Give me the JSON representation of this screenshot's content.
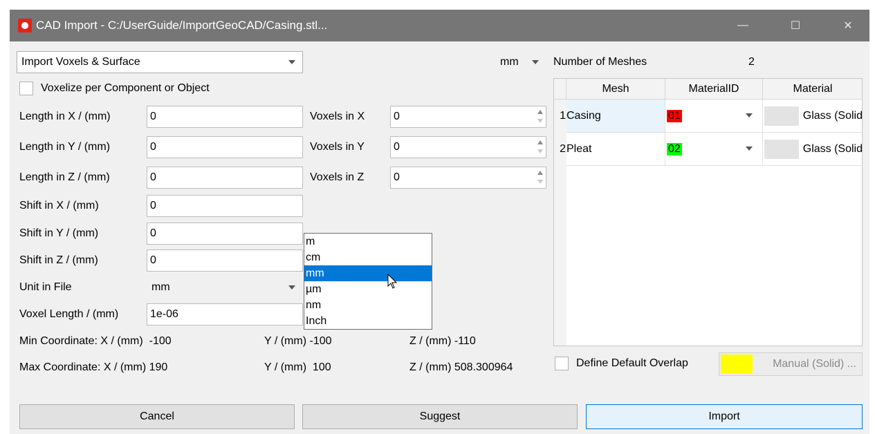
{
  "window": {
    "title": "CAD Import - C:/UserGuide/ImportGeoCAD/Casing.stl...",
    "minimize": "—",
    "maximize": "☐",
    "close": "✕"
  },
  "import_mode": {
    "value": "Import Voxels & Surface"
  },
  "unit_combo": {
    "value": "mm"
  },
  "voxelize_checkbox": {
    "label": "Voxelize per Component or Object",
    "checked": false
  },
  "fields": {
    "length_x": {
      "label": "Length in X / (mm)",
      "value": "0"
    },
    "length_y": {
      "label": "Length in Y / (mm)",
      "value": "0"
    },
    "length_z": {
      "label": "Length in Z / (mm)",
      "value": "0"
    },
    "shift_x": {
      "label": "Shift  in X / (mm)",
      "value": "0"
    },
    "shift_y": {
      "label": "Shift  in Y / (mm)",
      "value": "0"
    },
    "shift_z": {
      "label": "Shift  in Z / (mm)",
      "value": "0"
    },
    "voxels_x": {
      "label": "Voxels in X",
      "value": "0"
    },
    "voxels_y": {
      "label": "Voxels in Y",
      "value": "0"
    },
    "voxels_z": {
      "label": "Voxels in Z",
      "value": "0"
    },
    "unit_in_file": {
      "label": "Unit in File",
      "value": "mm"
    },
    "voxel_length": {
      "label": "Voxel Length / (mm)",
      "value": "1e-06"
    }
  },
  "unit_dropdown": {
    "options": [
      "m",
      "cm",
      "mm",
      "µm",
      "nm",
      "Inch"
    ],
    "selected": "mm"
  },
  "coords": {
    "min_label": "Min Coordinate: X / (mm)",
    "min_x": "-100",
    "min_y_label": "Y / (mm)",
    "min_y": "-100",
    "min_z_label": "Z / (mm)",
    "min_z": "-110",
    "max_label": "Max Coordinate: X / (mm)",
    "max_x": "190",
    "max_y_label": "Y / (mm)",
    "max_y": "100",
    "max_z_label": "Z / (mm)",
    "max_z": "508.300964"
  },
  "meshes": {
    "count_label": "Number of Meshes",
    "count": "2",
    "headers": [
      "Mesh",
      "MaterialID",
      "Material"
    ],
    "rows": [
      {
        "index": "1",
        "mesh": "Casing",
        "material_id": "01",
        "id_color": "#ff0000",
        "material": "Glass (Solid"
      },
      {
        "index": "2",
        "mesh": "Pleat",
        "material_id": "02",
        "id_color": "#00ff00",
        "material": "Glass (Solid"
      }
    ]
  },
  "overlap": {
    "label": "Define Default Overlap",
    "checked": false,
    "button_label": "Manual (Solid) ...",
    "swatch_color": "#ffff00"
  },
  "buttons": {
    "cancel": "Cancel",
    "suggest": "Suggest",
    "import": "Import"
  }
}
